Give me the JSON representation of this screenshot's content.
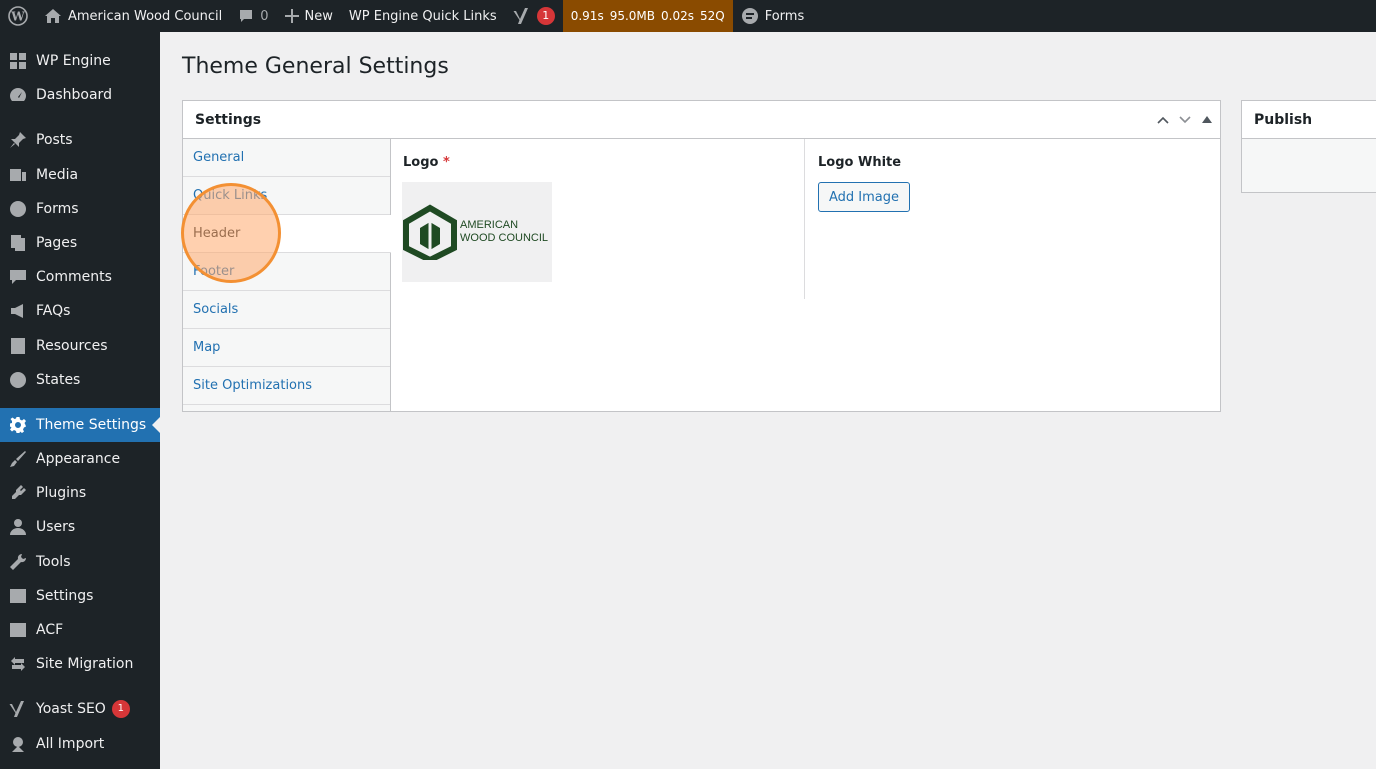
{
  "admin_bar": {
    "site_name": "American Wood Council",
    "comments_count": "0",
    "new_label": "New",
    "quick_links": "WP Engine Quick Links",
    "yoast_badge": "1",
    "query_monitor": {
      "time": "0.91s",
      "memory": "95.0MB",
      "db_time": "0.02s",
      "queries": "52Q"
    },
    "forms_label": "Forms"
  },
  "sidebar": {
    "items": [
      {
        "label": "WP Engine",
        "icon": "grid-icon"
      },
      {
        "label": "Dashboard",
        "icon": "dashboard-icon"
      },
      {
        "label": "Posts",
        "icon": "pin-icon"
      },
      {
        "label": "Media",
        "icon": "media-icon"
      },
      {
        "label": "Forms",
        "icon": "forms-icon"
      },
      {
        "label": "Pages",
        "icon": "pages-icon"
      },
      {
        "label": "Comments",
        "icon": "comments-icon"
      },
      {
        "label": "FAQs",
        "icon": "megaphone-icon"
      },
      {
        "label": "Resources",
        "icon": "building-icon"
      },
      {
        "label": "States",
        "icon": "globe-icon"
      },
      {
        "label": "Theme Settings",
        "icon": "gear-icon",
        "current": true
      },
      {
        "label": "Appearance",
        "icon": "brush-icon"
      },
      {
        "label": "Plugins",
        "icon": "plugin-icon"
      },
      {
        "label": "Users",
        "icon": "user-icon"
      },
      {
        "label": "Tools",
        "icon": "wrench-icon"
      },
      {
        "label": "Settings",
        "icon": "sliders-icon"
      },
      {
        "label": "ACF",
        "icon": "acf-icon"
      },
      {
        "label": "Site Migration",
        "icon": "arrows-icon"
      },
      {
        "label": "Yoast SEO",
        "icon": "yoast-icon",
        "badge": "1"
      },
      {
        "label": "All Import",
        "icon": "import-icon"
      }
    ]
  },
  "page": {
    "title": "Theme General Settings"
  },
  "settings": {
    "title": "Settings",
    "tabs": [
      "General",
      "Quick Links",
      "Header",
      "Footer",
      "Socials",
      "Map",
      "Site Optimizations"
    ],
    "active_tab": "Header",
    "logo_label": "Logo",
    "required_mark": "*",
    "logo_text_line1": "AMERICAN",
    "logo_text_line2": "WOOD COUNCIL",
    "logo_white_label": "Logo White",
    "add_image_label": "Add Image"
  },
  "publish": {
    "title": "Publish"
  },
  "colors": {
    "admin_dark": "#1d2327",
    "accent_blue": "#2271b1",
    "badge_red": "#d63638",
    "query_monitor_bg": "#8a4b00",
    "logo_green": "#1f4a23",
    "click_highlight": "#f39033"
  }
}
